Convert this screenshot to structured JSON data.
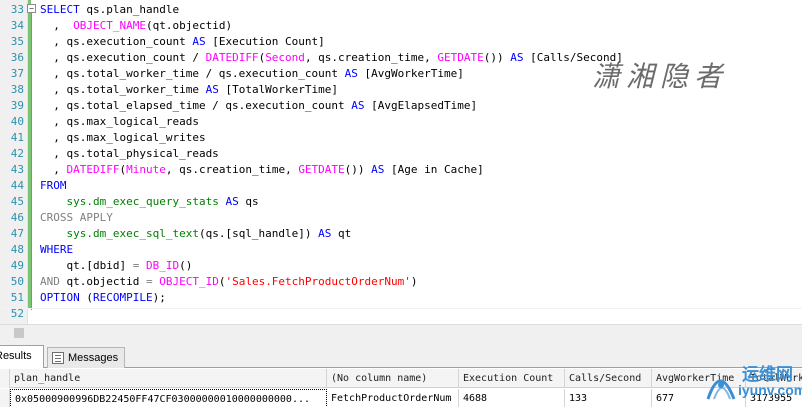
{
  "editor": {
    "lines": [
      {
        "num": "33",
        "tokens": [
          {
            "c": "k",
            "t": "SELECT"
          },
          {
            "c": "t",
            "t": " qs.plan_handle"
          }
        ]
      },
      {
        "num": "34",
        "tokens": [
          {
            "c": "t",
            "t": "  ,  "
          },
          {
            "c": "f",
            "t": "OBJECT_NAME"
          },
          {
            "c": "t",
            "t": "(qt.objectid)"
          }
        ]
      },
      {
        "num": "35",
        "tokens": [
          {
            "c": "t",
            "t": "  , qs.execution_count "
          },
          {
            "c": "k",
            "t": "AS"
          },
          {
            "c": "t",
            "t": " [Execution Count]"
          }
        ]
      },
      {
        "num": "36",
        "tokens": [
          {
            "c": "t",
            "t": "  , qs.execution_count / "
          },
          {
            "c": "f",
            "t": "DATEDIFF"
          },
          {
            "c": "t",
            "t": "("
          },
          {
            "c": "f",
            "t": "Second"
          },
          {
            "c": "t",
            "t": ", qs.creation_time, "
          },
          {
            "c": "f",
            "t": "GETDATE"
          },
          {
            "c": "t",
            "t": "()) "
          },
          {
            "c": "k",
            "t": "AS"
          },
          {
            "c": "t",
            "t": " [Calls/Second]"
          }
        ]
      },
      {
        "num": "37",
        "tokens": [
          {
            "c": "t",
            "t": "  , qs.total_worker_time / qs.execution_count "
          },
          {
            "c": "k",
            "t": "AS"
          },
          {
            "c": "t",
            "t": " [AvgWorkerTime]"
          }
        ]
      },
      {
        "num": "38",
        "tokens": [
          {
            "c": "t",
            "t": "  , qs.total_worker_time "
          },
          {
            "c": "k",
            "t": "AS"
          },
          {
            "c": "t",
            "t": " [TotalWorkerTime]"
          }
        ]
      },
      {
        "num": "39",
        "tokens": [
          {
            "c": "t",
            "t": "  , qs.total_elapsed_time / qs.execution_count "
          },
          {
            "c": "k",
            "t": "AS"
          },
          {
            "c": "t",
            "t": " [AvgElapsedTime]"
          }
        ]
      },
      {
        "num": "40",
        "tokens": [
          {
            "c": "t",
            "t": "  , qs.max_logical_reads"
          }
        ]
      },
      {
        "num": "41",
        "tokens": [
          {
            "c": "t",
            "t": "  , qs.max_logical_writes"
          }
        ]
      },
      {
        "num": "42",
        "tokens": [
          {
            "c": "t",
            "t": "  , qs.total_physical_reads"
          }
        ]
      },
      {
        "num": "43",
        "tokens": [
          {
            "c": "t",
            "t": "  , "
          },
          {
            "c": "f",
            "t": "DATEDIFF"
          },
          {
            "c": "t",
            "t": "("
          },
          {
            "c": "f",
            "t": "Minute"
          },
          {
            "c": "t",
            "t": ", qs.creation_time, "
          },
          {
            "c": "f",
            "t": "GETDATE"
          },
          {
            "c": "t",
            "t": "()) "
          },
          {
            "c": "k",
            "t": "AS"
          },
          {
            "c": "t",
            "t": " [Age in Cache]"
          }
        ]
      },
      {
        "num": "44",
        "tokens": [
          {
            "c": "k",
            "t": "FROM"
          }
        ]
      },
      {
        "num": "45",
        "tokens": [
          {
            "c": "t",
            "t": "    "
          },
          {
            "c": "sy",
            "t": "sys.dm_exec_query_stats"
          },
          {
            "c": "t",
            "t": " "
          },
          {
            "c": "k",
            "t": "AS"
          },
          {
            "c": "t",
            "t": " qs"
          }
        ]
      },
      {
        "num": "46",
        "tokens": [
          {
            "c": "g",
            "t": "CROSS APPLY"
          }
        ]
      },
      {
        "num": "47",
        "tokens": [
          {
            "c": "t",
            "t": "    "
          },
          {
            "c": "sy",
            "t": "sys.dm_exec_sql_text"
          },
          {
            "c": "t",
            "t": "(qs.[sql_handle]) "
          },
          {
            "c": "k",
            "t": "AS"
          },
          {
            "c": "t",
            "t": " qt"
          }
        ]
      },
      {
        "num": "48",
        "tokens": [
          {
            "c": "k",
            "t": "WHERE"
          }
        ]
      },
      {
        "num": "49",
        "tokens": [
          {
            "c": "t",
            "t": "    qt.[dbid] "
          },
          {
            "c": "g",
            "t": "="
          },
          {
            "c": "t",
            "t": " "
          },
          {
            "c": "f",
            "t": "DB_ID"
          },
          {
            "c": "t",
            "t": "()"
          }
        ]
      },
      {
        "num": "50",
        "tokens": [
          {
            "c": "g",
            "t": "AND"
          },
          {
            "c": "t",
            "t": " qt.objectid "
          },
          {
            "c": "g",
            "t": "="
          },
          {
            "c": "t",
            "t": " "
          },
          {
            "c": "f",
            "t": "OBJECT_ID"
          },
          {
            "c": "t",
            "t": "("
          },
          {
            "c": "s",
            "t": "'Sales.FetchProductOrderNum'"
          },
          {
            "c": "t",
            "t": ")"
          }
        ]
      },
      {
        "num": "51",
        "tokens": [
          {
            "c": "k",
            "t": "OPTION"
          },
          {
            "c": "t",
            "t": " ("
          },
          {
            "c": "k",
            "t": "RECOMPILE"
          },
          {
            "c": "t",
            "t": ");"
          }
        ]
      },
      {
        "num": "52",
        "tokens": []
      }
    ],
    "watermark": "潇湘隐者"
  },
  "results_tabs": {
    "results_label": "Results",
    "messages_label": "Messages"
  },
  "grid": {
    "columns": [
      "plan_handle",
      "(No column name)",
      "Execution Count",
      "Calls/Second",
      "AvgWorkerTime",
      "TotalWorkerTime"
    ],
    "rows": [
      [
        "0x05000900996DB22450FF47CF03000000010000000000...",
        "FetchProductOrderNum",
        "4688",
        "133",
        "677",
        "3173955"
      ]
    ]
  },
  "logo": {
    "text_cn": "运维网",
    "text_en": "iyunv.com"
  }
}
